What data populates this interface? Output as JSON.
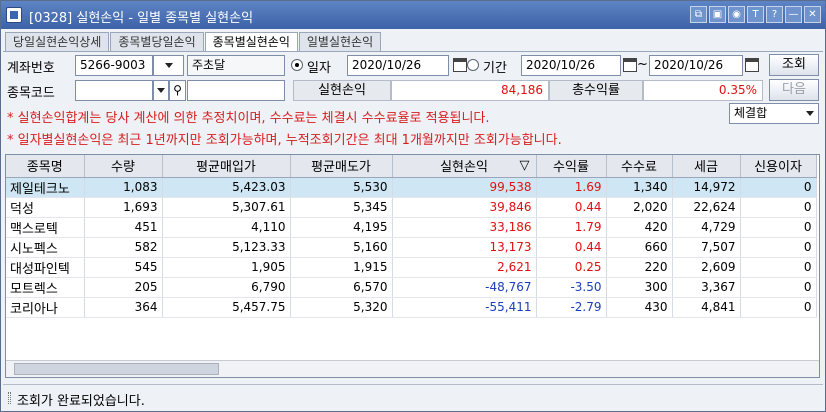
{
  "window": {
    "title": "[0328] 실현손익 - 일별 종목별 실현손익",
    "buttons": [
      "⧉",
      "▣",
      "◉",
      "T",
      "?",
      "—",
      "✕"
    ]
  },
  "tabs": [
    {
      "label": "당일실현손익상세",
      "active": false
    },
    {
      "label": "종목별당일손익",
      "active": false
    },
    {
      "label": "종목별실현손익",
      "active": true
    },
    {
      "label": "일별실현손익",
      "active": false
    }
  ],
  "form": {
    "account_label": "계좌번호",
    "account_number": "5266-9003",
    "account_owner": "주초달",
    "date_radio_label": "일자",
    "date_value": "2020/10/26",
    "period_radio_label": "기간",
    "period_start": "2020/10/26",
    "period_tilde": "~",
    "period_end": "2020/10/26",
    "search_button": "조회",
    "stock_code_label": "종목코드",
    "stock_code_value": "",
    "stock_name_value": "",
    "realized_label": "실현손익",
    "realized_value": "84,186",
    "return_label": "총수익률",
    "return_value": "0.35%",
    "next_button": "다음",
    "filter_select": "체결합"
  },
  "notices": [
    "* 실현손익합계는 당사 계산에 의한 추정치이며, 수수료는 체결시 수수료율로 적용됩니다.",
    "* 일자별실현손익은 최근 1년까지만 조회가능하며, 누적조회기간은 최대 1개월까지만 조회가능합니다."
  ],
  "table": {
    "columns": [
      "종목명",
      "수량",
      "평균매입가",
      "평균매도가",
      "실현손익",
      "수익률",
      "수수료",
      "세금",
      "신용이자"
    ],
    "sort_indicator": "▽",
    "rows": [
      {
        "name": "제일테크노",
        "qty": "1,083",
        "avg_buy": "5,423.03",
        "avg_sell": "5,530",
        "pnl": "99,538",
        "rate": "1.69",
        "fee": "1,340",
        "tax": "14,972",
        "interest": "0",
        "sign": "pos"
      },
      {
        "name": "덕성",
        "qty": "1,693",
        "avg_buy": "5,307.61",
        "avg_sell": "5,345",
        "pnl": "39,846",
        "rate": "0.44",
        "fee": "2,020",
        "tax": "22,624",
        "interest": "0",
        "sign": "pos"
      },
      {
        "name": "맥스로텍",
        "qty": "451",
        "avg_buy": "4,110",
        "avg_sell": "4,195",
        "pnl": "33,186",
        "rate": "1.79",
        "fee": "420",
        "tax": "4,729",
        "interest": "0",
        "sign": "pos"
      },
      {
        "name": "시노펙스",
        "qty": "582",
        "avg_buy": "5,123.33",
        "avg_sell": "5,160",
        "pnl": "13,173",
        "rate": "0.44",
        "fee": "660",
        "tax": "7,507",
        "interest": "0",
        "sign": "pos"
      },
      {
        "name": "대성파인텍",
        "qty": "545",
        "avg_buy": "1,905",
        "avg_sell": "1,915",
        "pnl": "2,621",
        "rate": "0.25",
        "fee": "220",
        "tax": "2,609",
        "interest": "0",
        "sign": "pos"
      },
      {
        "name": "모트렉스",
        "qty": "205",
        "avg_buy": "6,790",
        "avg_sell": "6,570",
        "pnl": "-48,767",
        "rate": "-3.50",
        "fee": "300",
        "tax": "3,367",
        "interest": "0",
        "sign": "neg"
      },
      {
        "name": "코리아나",
        "qty": "364",
        "avg_buy": "5,457.75",
        "avg_sell": "5,320",
        "pnl": "-55,411",
        "rate": "-2.79",
        "fee": "430",
        "tax": "4,841",
        "interest": "0",
        "sign": "neg"
      }
    ]
  },
  "status": {
    "message": "조회가 완료되었습니다."
  },
  "colors": {
    "positive": "#e01010",
    "negative": "#1a3fb8",
    "selected_row": "#cfe7f4",
    "titlebar": "#3d62a8"
  }
}
